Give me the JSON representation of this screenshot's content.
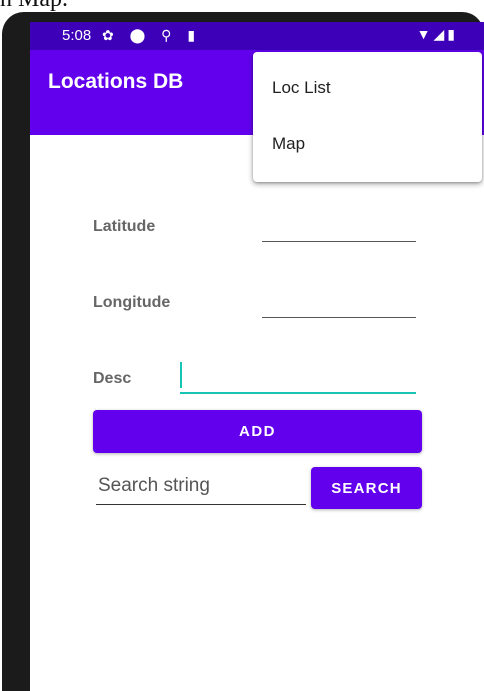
{
  "caption": "n Map.",
  "status_bar": {
    "time": "5:08",
    "left_icons": "✿ ⬤ ⚲ ▮",
    "right_icons": "▼◢▮"
  },
  "app_bar": {
    "title": "Locations DB"
  },
  "overflow_menu": {
    "items": [
      {
        "label": "Loc List"
      },
      {
        "label": "Map"
      }
    ]
  },
  "form": {
    "latitude_label": "Latitude",
    "longitude_label": "Longitude",
    "desc_label": "Desc",
    "add_label": "ADD"
  },
  "search": {
    "placeholder": "Search string",
    "button_label": "SEARCH"
  },
  "colors": {
    "primary": "#6200ee",
    "status_bar": "#3d00b8",
    "focus_accent": "#17c4b5"
  }
}
